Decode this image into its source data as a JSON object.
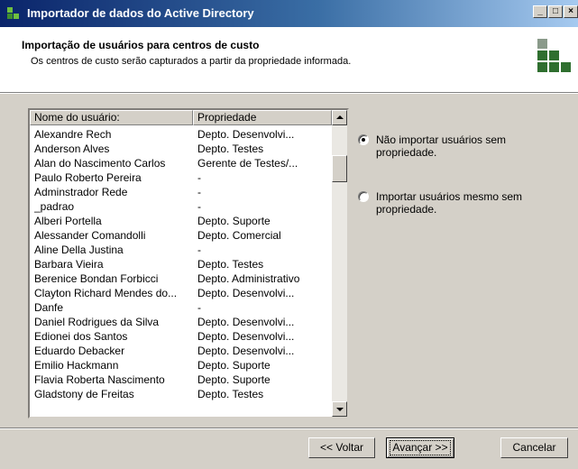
{
  "window": {
    "title": "Importador de dados do Active Directory",
    "minimize_icon": "minimize-icon",
    "maximize_icon": "maximize-icon",
    "close_icon": "close-icon"
  },
  "header": {
    "title": "Importação de usuários para centros de custo",
    "subtitle": "Os centros de custo serão capturados a partir da propriedade informada."
  },
  "list": {
    "columns": [
      "Nome do usuário:",
      "Propriedade"
    ],
    "rows": [
      [
        "Alexandre Rech",
        "Depto. Desenvolvi..."
      ],
      [
        "Anderson Alves",
        "Depto. Testes"
      ],
      [
        "Alan do Nascimento Carlos",
        "Gerente de Testes/..."
      ],
      [
        "Paulo Roberto Pereira",
        "-"
      ],
      [
        "Adminstrador Rede",
        "-"
      ],
      [
        "_padrao",
        "-"
      ],
      [
        "Alberi Portella",
        "Depto. Suporte"
      ],
      [
        "Alessander Comandolli",
        "Depto. Comercial"
      ],
      [
        "Aline Della Justina",
        "-"
      ],
      [
        "Barbara Vieira",
        "Depto. Testes"
      ],
      [
        "Berenice Bondan Forbicci",
        "Depto. Administrativo"
      ],
      [
        "Clayton Richard Mendes do...",
        "Depto. Desenvolvi..."
      ],
      [
        "Danfe",
        "-"
      ],
      [
        "Daniel Rodrigues da Silva",
        "Depto. Desenvolvi..."
      ],
      [
        "Edionei dos Santos",
        "Depto. Desenvolvi..."
      ],
      [
        "Eduardo Debacker",
        "Depto. Desenvolvi..."
      ],
      [
        "Emilio Hackmann",
        "Depto. Suporte"
      ],
      [
        "Flavia Roberta Nascimento",
        "Depto. Suporte"
      ],
      [
        "Gladstony de Freitas",
        "Depto. Testes"
      ]
    ]
  },
  "options": [
    {
      "label": "Não importar usuários sem propriedade.",
      "selected": true
    },
    {
      "label": "Importar usuários mesmo sem propriedade.",
      "selected": false
    }
  ],
  "buttons": {
    "back": "<< Voltar",
    "next": "Avançar >>",
    "cancel": "Cancelar"
  },
  "colors": {
    "title_gradient_start": "#0a246a",
    "title_gradient_end": "#a6caf0",
    "logo_green": "#2f6f2f"
  }
}
